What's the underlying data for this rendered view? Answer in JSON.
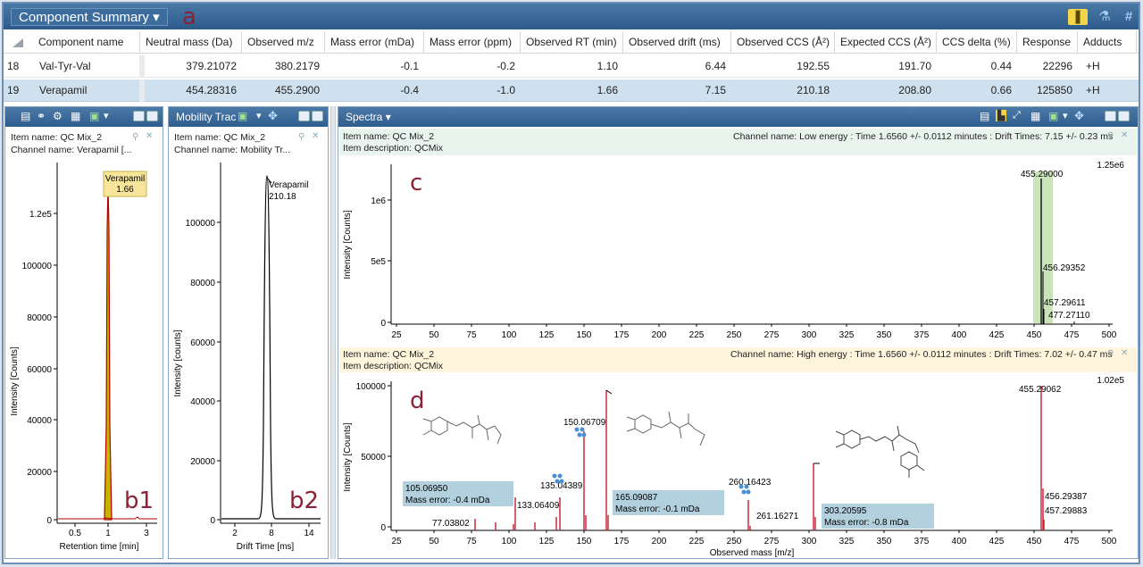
{
  "header": {
    "title": "Component Summary",
    "letter": "a"
  },
  "table": {
    "columns": [
      "Component name",
      "Neutral mass (Da)",
      "Observed m/z",
      "Mass error (mDa)",
      "Mass error (ppm)",
      "Observed RT (min)",
      "Observed drift (ms)",
      "Observed CCS (Å²)",
      "Expected CCS (Å²)",
      "CCS delta (%)",
      "Response",
      "Adducts"
    ],
    "rows": [
      {
        "index": "18",
        "name": "Val-Tyr-Val",
        "neutral": "379.21072",
        "mz": "380.2179",
        "err_mda": "-0.1",
        "err_ppm": "-0.2",
        "rt": "1.10",
        "drift": "6.44",
        "ccs": "192.55",
        "exp_ccs": "191.70",
        "delta": "0.44",
        "response": "22296",
        "adduct": "+H"
      },
      {
        "index": "19",
        "name": "Verapamil",
        "neutral": "454.28316",
        "mz": "455.2900",
        "err_mda": "-0.4",
        "err_ppm": "-1.0",
        "rt": "1.66",
        "drift": "7.15",
        "ccs": "210.18",
        "exp_ccs": "208.80",
        "delta": "0.66",
        "response": "125850",
        "adduct": "+H"
      }
    ]
  },
  "chrom": {
    "item_name": "Item name: QC Mix_2",
    "channel": "Channel name: Verapamil [...",
    "letter": "b1",
    "peak_label": "Verapamil",
    "peak_value": "1.66",
    "ylabel": "Intensity [Counts]",
    "xlabel": "Retention time [min]",
    "yticks": [
      "1.2e5",
      "100000",
      "80000",
      "60000",
      "40000",
      "20000",
      "0"
    ],
    "xticks": [
      "0.5",
      "1",
      "3"
    ]
  },
  "mobility": {
    "title": "Mobility Trac",
    "item_name": "Item name: QC Mix_2",
    "channel": "Channel name: Mobility Tr...",
    "letter": "b2",
    "peak_label": "Verapamil",
    "peak_value": "210.18",
    "ylabel": "Intensity [counts]",
    "xlabel": "Drift Time [ms]",
    "yticks": [
      "100000",
      "80000",
      "60000",
      "40000",
      "20000",
      "0"
    ],
    "xticks": [
      "2",
      "8",
      "14"
    ]
  },
  "spectra": {
    "title": "Spectra",
    "low": {
      "item_name": "Item name: QC Mix_2",
      "channel": "Channel name: Low energy : Time 1.6560 +/- 0.0112 minutes : Drift Times: 7.15 +/- 0.23 ms",
      "desc": "Item description: QCMix",
      "letter": "c",
      "scale": "1.25e6",
      "ylabel": "Intensity [Counts]",
      "yticks": [
        "1e6",
        "5e5",
        "0"
      ],
      "peak_labels": [
        "455.29000",
        "456.29352",
        "457.29611",
        "477.27110"
      ]
    },
    "high": {
      "item_name": "Item name: QC Mix_2",
      "channel": "Channel name: High energy : Time 1.6560 +/- 0.0112 minutes : Drift Times: 7.02 +/- 0.47 ms",
      "desc": "Item description: QCMix",
      "letter": "d",
      "scale": "1.02e5",
      "ylabel": "Intensity [Counts]",
      "yticks": [
        "100000",
        "50000",
        "0"
      ],
      "peak_labels": [
        "455.29062",
        "150.06709",
        "135.04389",
        "133.06409",
        "77.03802",
        "260.16423",
        "261.16271",
        "456.29387",
        "457.29883"
      ],
      "boxes": [
        {
          "mz": "105.06950",
          "err": "Mass error: -0.4 mDa"
        },
        {
          "mz": "165.09087",
          "err": "Mass error: -0.1 mDa"
        },
        {
          "mz": "303.20595",
          "err": "Mass error: -0.8 mDa"
        }
      ]
    },
    "xlabel": "Observed mass [m/z]",
    "xticks": [
      "25",
      "50",
      "75",
      "100",
      "125",
      "150",
      "175",
      "200",
      "225",
      "250",
      "275",
      "300",
      "325",
      "350",
      "375",
      "400",
      "425",
      "450",
      "475",
      "500"
    ]
  },
  "colors": {
    "header": "#2f5d8e",
    "selected_row": "#cfe0ee",
    "trace": "#b30000",
    "peak_fill": "#c8b400",
    "highlight": "#b5dba0"
  }
}
